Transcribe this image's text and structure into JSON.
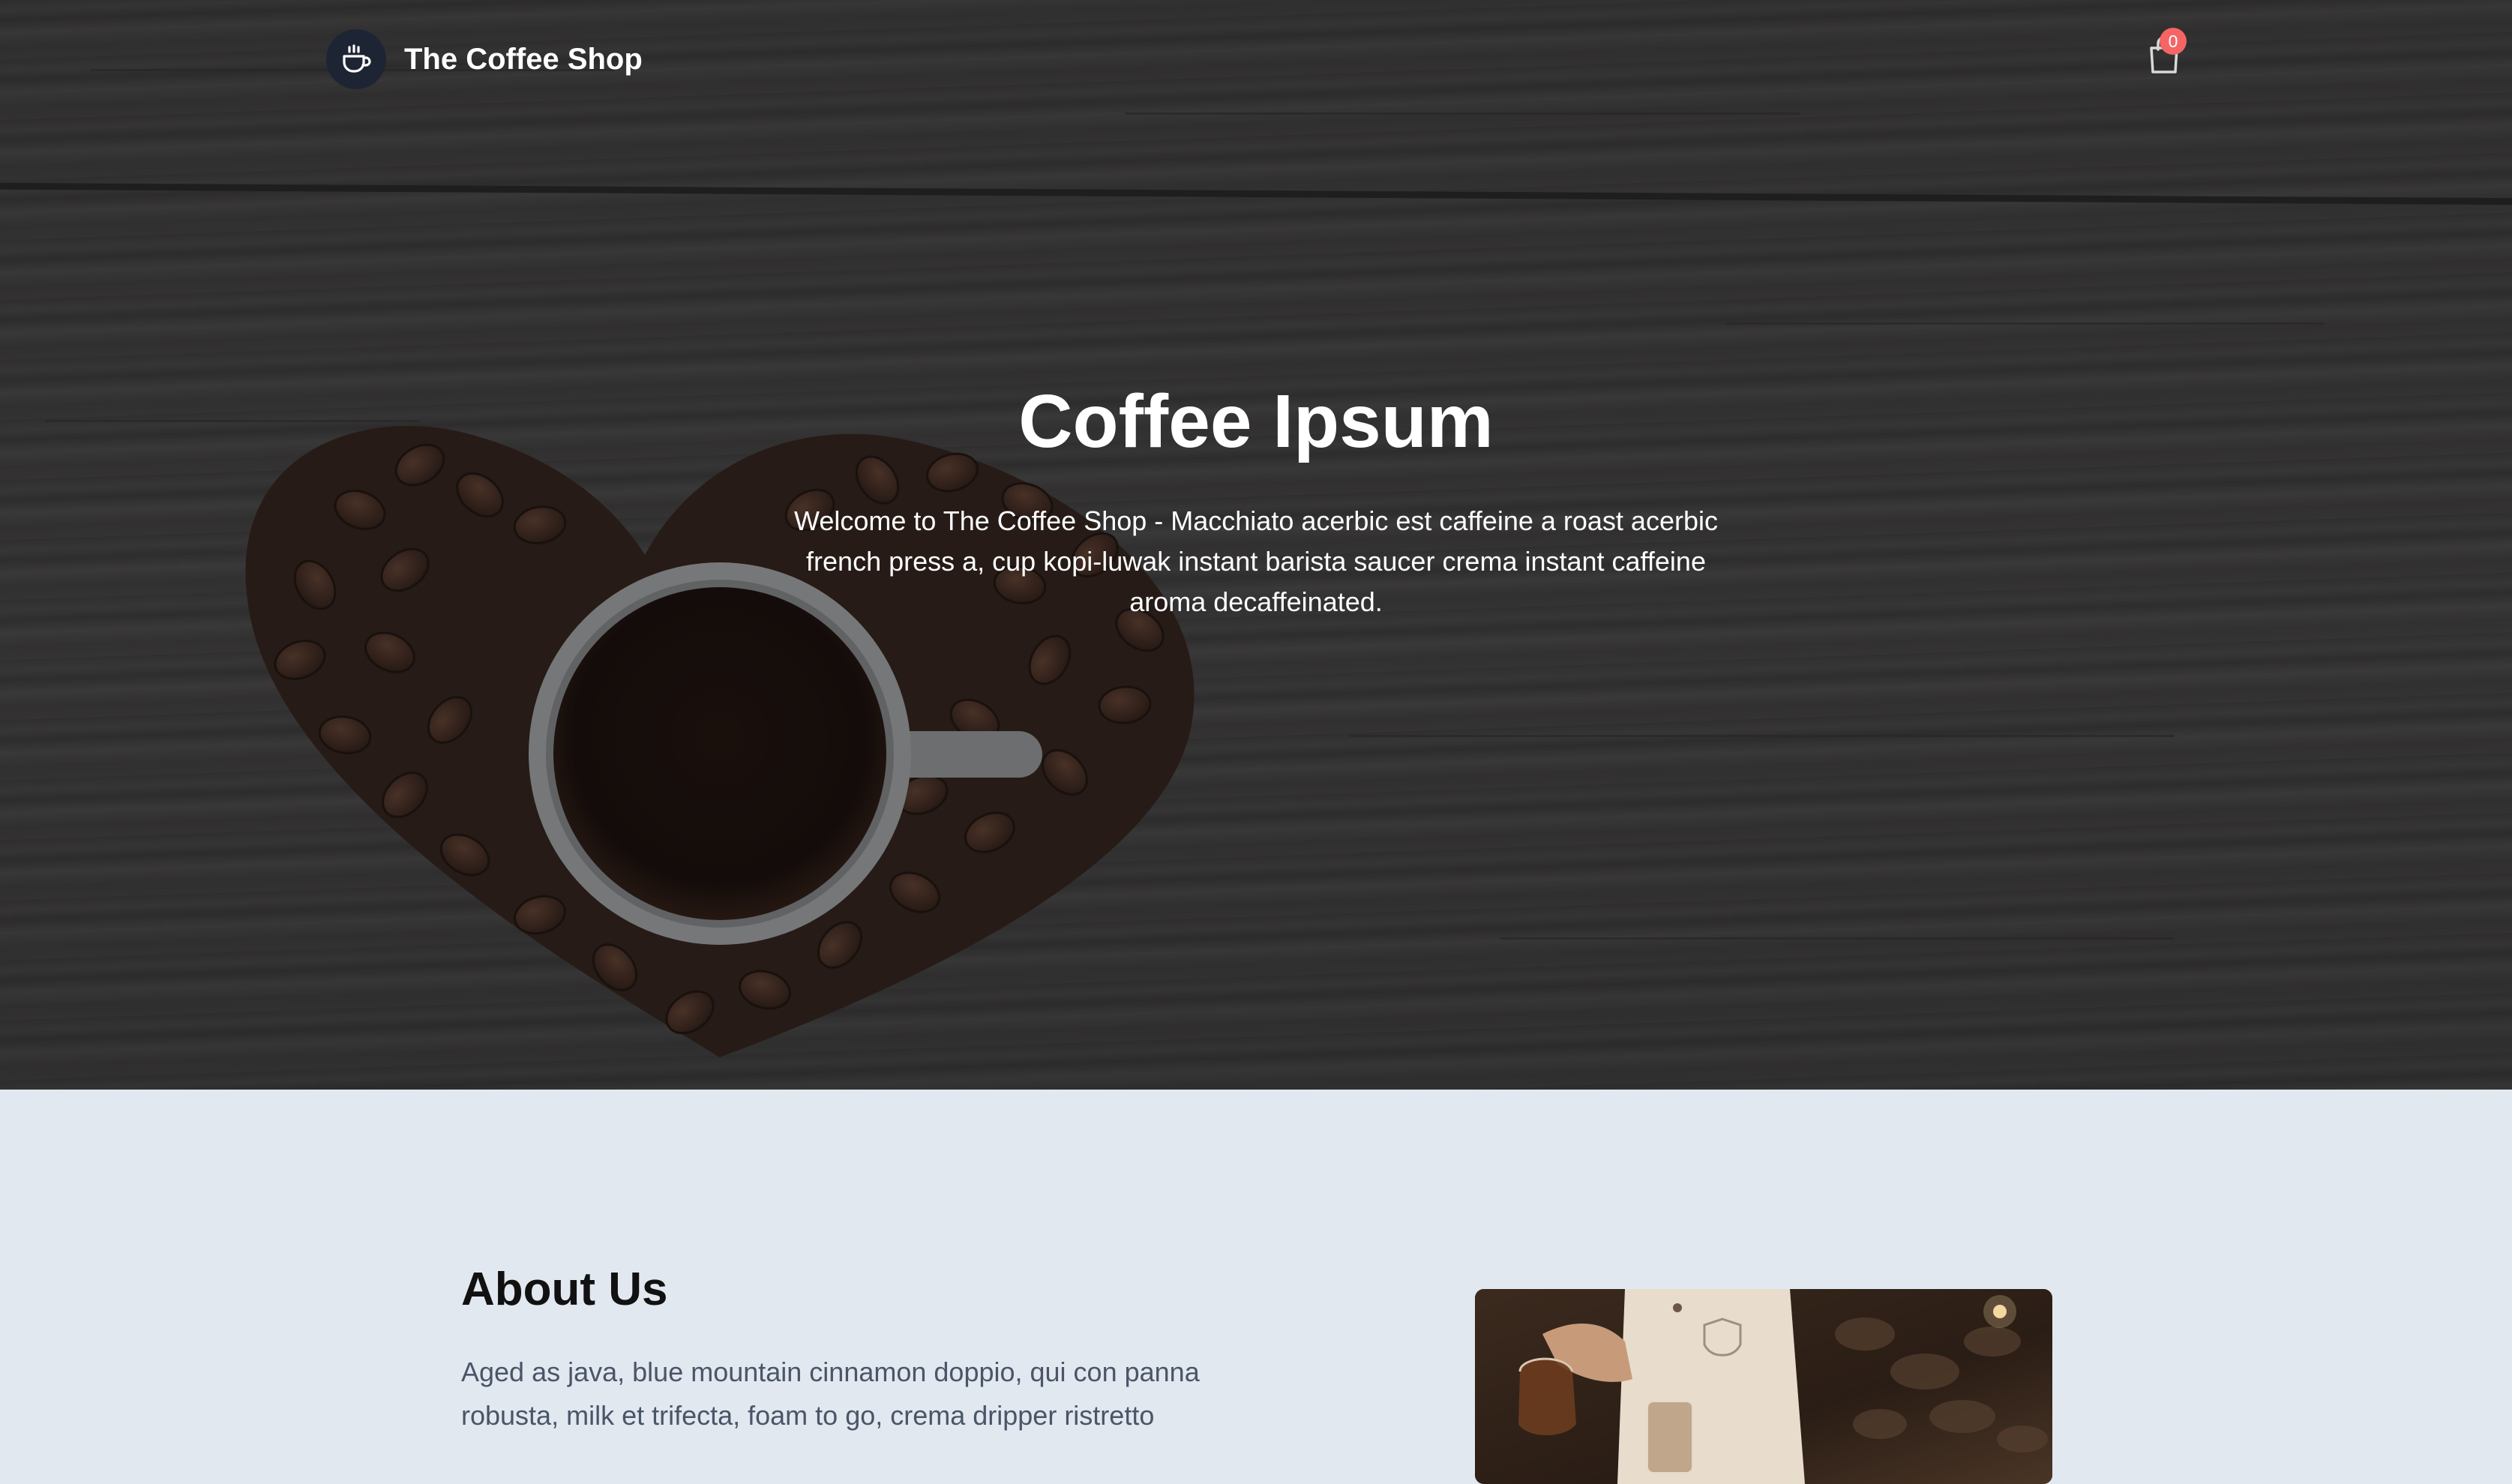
{
  "header": {
    "brand_name": "The Coffee Shop",
    "logo_icon": "coffee-cup-icon",
    "cart_icon": "shopping-bag-icon",
    "cart_count": "0"
  },
  "hero": {
    "title": "Coffee Ipsum",
    "text": "Welcome to The Coffee Shop - Macchiato acerbic est caffeine a roast acerbic french press a, cup kopi-luwak instant barista saucer crema instant caffeine aroma decaffeinated."
  },
  "about": {
    "title": "About Us",
    "text": "Aged as java, blue mountain cinnamon doppio, qui con panna robusta, milk et trifecta, foam to go, crema dripper ristretto"
  },
  "colors": {
    "logo_badge": "#1d2434",
    "cart_badge": "#f56565",
    "section_bg": "#e2e8f0",
    "body_text": "#4a5568"
  }
}
